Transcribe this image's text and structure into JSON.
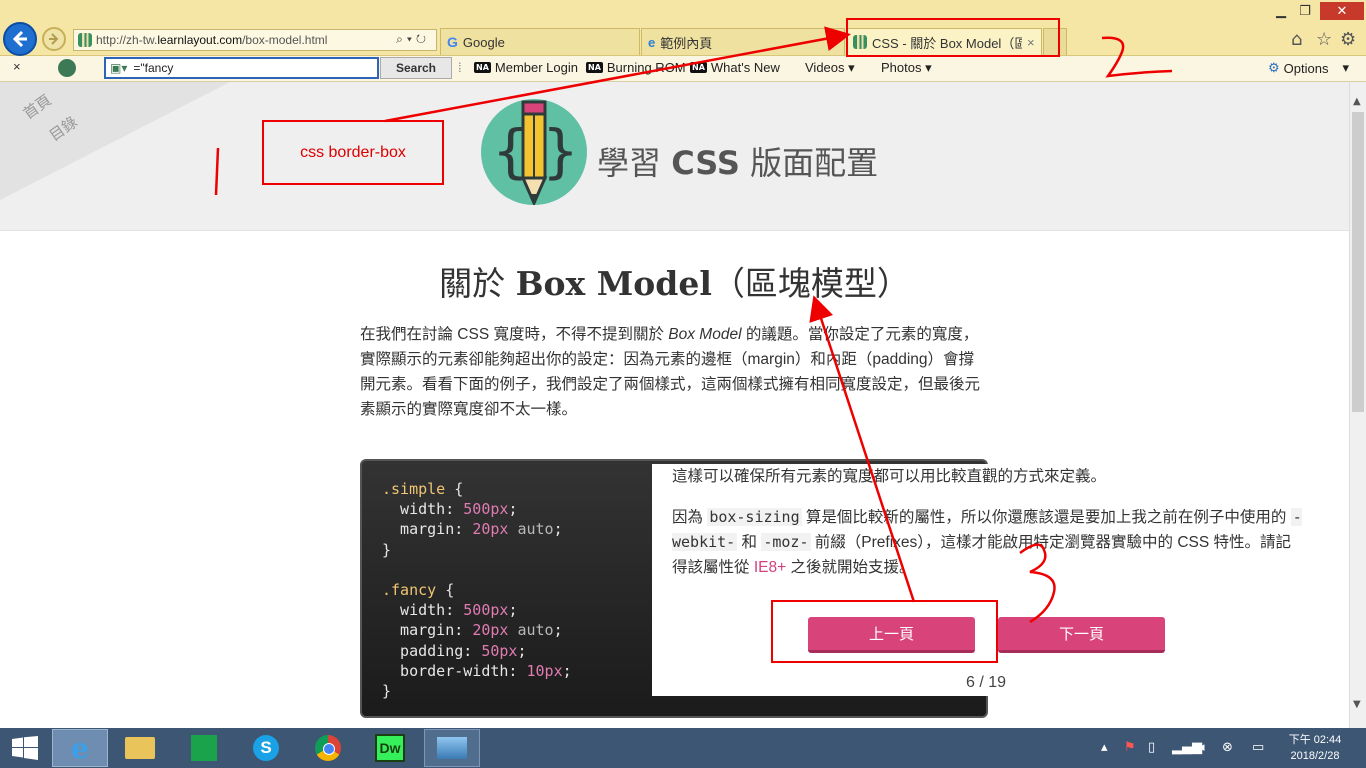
{
  "browser": {
    "address_url_prefix": "http://zh-tw.",
    "address_url_domain": "learnlayout.com",
    "address_url_path": "/box-model.html",
    "tabs": [
      {
        "label": "Google"
      },
      {
        "label": "範例內頁"
      },
      {
        "label": "CSS - 關於 Box Model（區…",
        "active": true
      }
    ],
    "tab_close": "×"
  },
  "toolbar": {
    "close": "×",
    "search_value": "=\"fancy",
    "search_button": "Search",
    "links": [
      "Member Login",
      "Burning ROM",
      "What's New",
      "Videos ▾",
      "Photos ▾"
    ],
    "na_badge": "NA",
    "options": "Options"
  },
  "page": {
    "corner_home": "首頁",
    "corner_toc": "目錄",
    "site_title_prefix": "學習 ",
    "site_title_bold": "CSS",
    "site_title_suffix": " 版面配置",
    "title_prefix": "關於 ",
    "title_bold": "Box Model",
    "title_suffix": "（區塊模型）",
    "intro_1": "在我們在討論 CSS 寬度時，不得不提到關於 ",
    "intro_em": "Box Model",
    "intro_2": " 的議題。當你設定了元素的寬度，實際顯示的元素卻能夠超出你的設定：因為元素的邊框（margin）和內距（padding）會撐開元素。看看下面的例子，我們設定了兩個樣式，這兩個樣式擁有相同寬度設定，但最後元素顯示的實際寬度卻不太一樣。",
    "code": {
      "simple_sel": ".simple",
      "fancy_sel": ".fancy",
      "brace_open": " {",
      "brace_close": "}",
      "width_prop": "  width: ",
      "margin_prop": "  margin: ",
      "padding_prop": "  padding: ",
      "border_prop": "  border-width: ",
      "v500": "500px",
      "v20": "20px",
      "v50": "50px",
      "v10": "10px",
      "auto": " auto",
      "semi": ";"
    },
    "overlay_line1": "這樣可以確保所有元素的寬度都可以用比較直觀的方式來定義。",
    "overlay_p2_a": "因為 ",
    "overlay_p2_code1": "box-sizing",
    "overlay_p2_b": " 算是個比較新的屬性，所以你還應該還是要加上我之前在例子中使用的 ",
    "overlay_p2_code2": "-webkit-",
    "overlay_p2_c": " 和 ",
    "overlay_p2_code3": "-moz-",
    "overlay_p2_d": " 前綴（Prefixes），這樣才能啟用特定瀏覽器實驗中的 CSS 特性。請記得該屬性從 ",
    "overlay_p2_ie": "IE8+",
    "overlay_p2_e": " 之後就開始支援。",
    "prev_button": "上一頁",
    "next_button": "下一頁",
    "page_count": "6 / 19"
  },
  "annotation": {
    "label": "css border-box",
    "color": "#e00000"
  },
  "taskbar": {
    "time": "下午 02:44",
    "date": "2018/2/28",
    "dw_label": "Dw"
  },
  "colors": {
    "accent_pink": "#d8447a",
    "teal_logo": "#5fc0a3",
    "titlebar": "#f6e6a6",
    "taskbar": "#3c5673"
  }
}
